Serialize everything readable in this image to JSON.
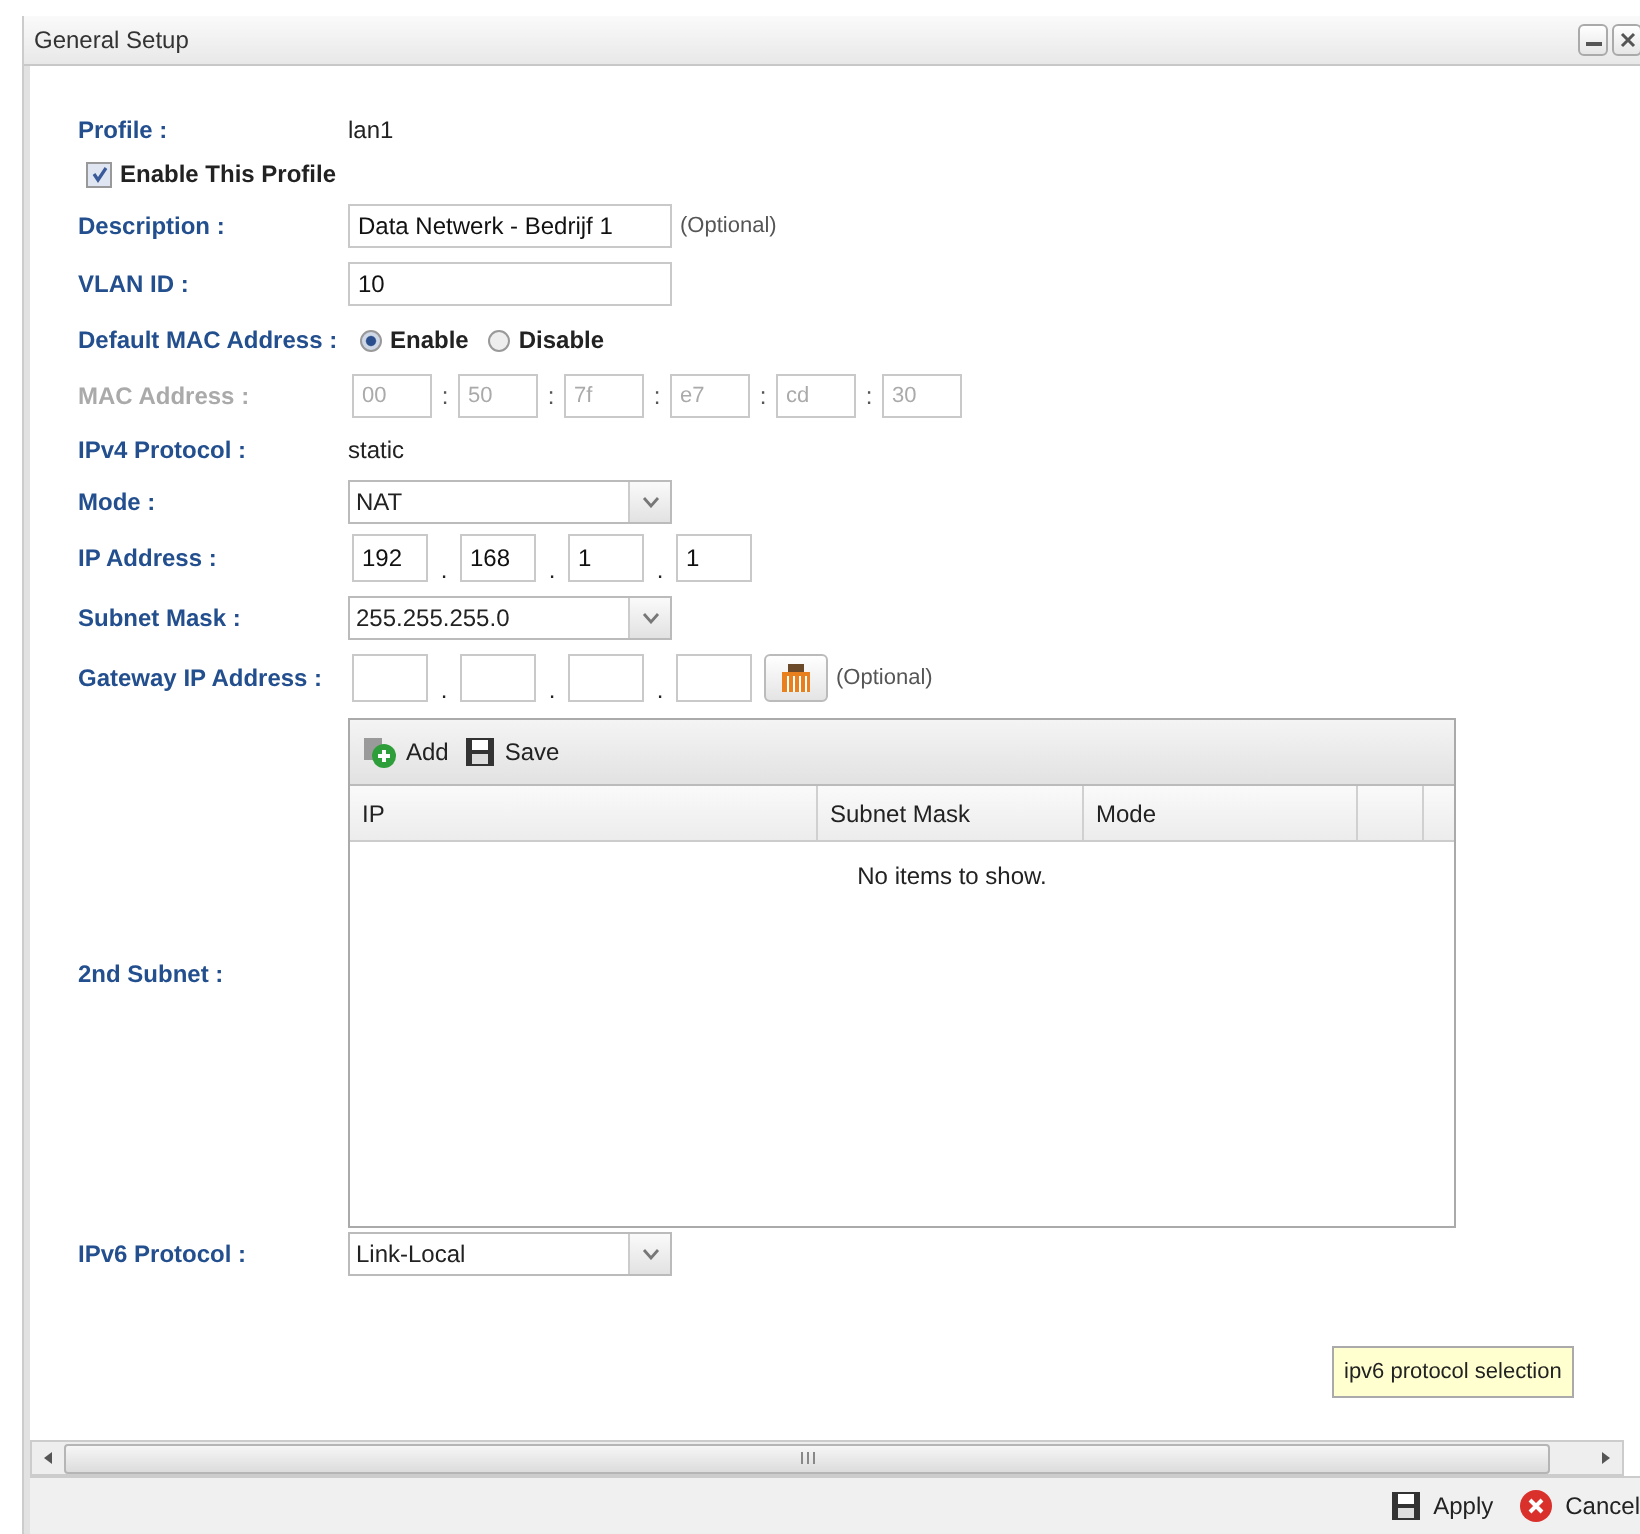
{
  "window": {
    "title": "General Setup"
  },
  "profile": {
    "label": "Profile :",
    "value": "lan1"
  },
  "enable_profile": {
    "label": "Enable This Profile",
    "checked": true
  },
  "description": {
    "label": "Description :",
    "value": "Data Netwerk - Bedrijf 1",
    "hint": "(Optional)"
  },
  "vlan_id": {
    "label": "VLAN ID :",
    "value": "10"
  },
  "default_mac": {
    "label": "Default MAC Address :",
    "options": [
      {
        "label": "Enable",
        "selected": true
      },
      {
        "label": "Disable",
        "selected": false
      }
    ]
  },
  "mac_address": {
    "label": "MAC Address :",
    "disabled": true,
    "octets": [
      "00",
      "50",
      "7f",
      "e7",
      "cd",
      "30"
    ],
    "separators": [
      ":",
      ":",
      ":",
      ":",
      ":"
    ]
  },
  "ipv4_protocol": {
    "label": "IPv4 Protocol :",
    "value": "static"
  },
  "mode": {
    "label": "Mode :",
    "value": "NAT"
  },
  "ip_address": {
    "label": "IP Address :",
    "octets": [
      "192",
      "168",
      "1",
      "1"
    ],
    "separators": [
      ".",
      ".",
      "."
    ]
  },
  "subnet_mask": {
    "label": "Subnet Mask :",
    "value": "255.255.255.0"
  },
  "gateway": {
    "label": "Gateway IP Address :",
    "separators": [
      ".",
      ".",
      "."
    ],
    "hint": "(Optional)"
  },
  "second_subnet": {
    "label": "2nd Subnet :",
    "toolbar": [
      {
        "kind": "add",
        "label": "Add"
      },
      {
        "kind": "save",
        "label": "Save"
      }
    ],
    "columns": [
      "IP",
      "Subnet Mask",
      "Mode"
    ],
    "empty_text": "No items to show."
  },
  "ipv6_protocol": {
    "label": "IPv6 Protocol :",
    "value": "Link-Local"
  },
  "tooltip": "ipv6 protocol selection",
  "buttons": [
    {
      "kind": "apply",
      "label": "Apply"
    },
    {
      "kind": "cancel",
      "label": "Cancel"
    }
  ]
}
